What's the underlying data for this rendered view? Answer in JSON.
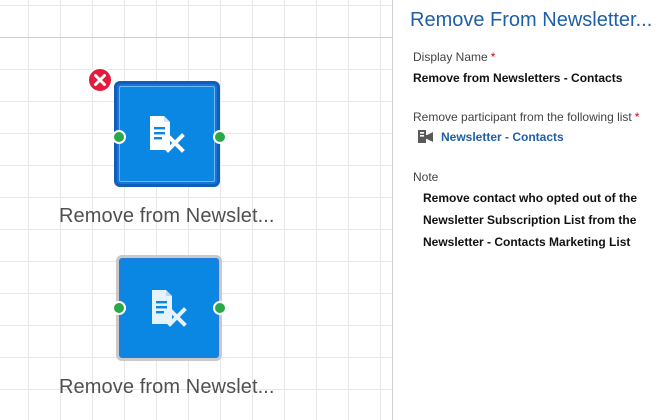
{
  "canvas": {
    "nodes": [
      {
        "label": "Remove from Newslet...",
        "selected": true,
        "icon": "remove-list-member-icon"
      },
      {
        "label": "Remove from Newslet...",
        "selected": false,
        "icon": "remove-list-member-icon"
      }
    ],
    "delete_icon": "close-icon"
  },
  "panel": {
    "title": "Remove From Newsletter...",
    "display_name": {
      "label": "Display Name",
      "required_mark": "*",
      "value": "Remove from Newsletters - Contacts"
    },
    "list": {
      "label": "Remove participant from the following list",
      "required_mark": "*",
      "value": "Newsletter - Contacts",
      "icon": "marketing-list-icon"
    },
    "note": {
      "label": "Note",
      "value": "Remove contact who opted out of the Newsletter Subscription List from the Newsletter - Contacts Marketing List"
    }
  },
  "colors": {
    "tile_blue": "#0a86e3",
    "selected_border": "#0f5fb8",
    "port_green": "#2aa84a",
    "delete_red": "#e31b3c",
    "title_blue": "#1f5fa8",
    "required_red": "#d0021b"
  }
}
